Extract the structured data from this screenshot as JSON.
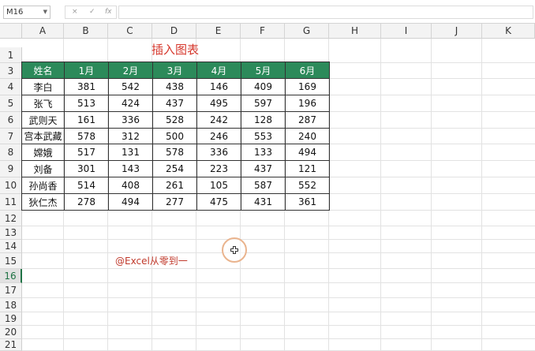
{
  "name_box": "M16",
  "formula_icons": [
    "×",
    "✓",
    "fx"
  ],
  "columns": [
    "A",
    "B",
    "C",
    "D",
    "E",
    "F",
    "G",
    "H",
    "I",
    "J",
    "K"
  ],
  "rows": [
    "1",
    "3",
    "4",
    "5",
    "6",
    "7",
    "8",
    "9",
    "10",
    "11",
    "12",
    "13",
    "14",
    "15",
    "16",
    "17",
    "18",
    "19",
    "20",
    "21"
  ],
  "active_row": "16",
  "title": "插入图表",
  "table": {
    "headers": [
      "姓名",
      "1月",
      "2月",
      "3月",
      "4月",
      "5月",
      "6月"
    ],
    "rows": [
      [
        "李白",
        "381",
        "542",
        "438",
        "146",
        "409",
        "169"
      ],
      [
        "张飞",
        "513",
        "424",
        "437",
        "495",
        "597",
        "196"
      ],
      [
        "武则天",
        "161",
        "336",
        "528",
        "242",
        "128",
        "287"
      ],
      [
        "宫本武藏",
        "578",
        "312",
        "500",
        "246",
        "553",
        "240"
      ],
      [
        "嫦娥",
        "517",
        "131",
        "578",
        "336",
        "133",
        "494"
      ],
      [
        "刘备",
        "301",
        "143",
        "254",
        "223",
        "437",
        "121"
      ],
      [
        "孙尚香",
        "514",
        "408",
        "261",
        "105",
        "587",
        "552"
      ],
      [
        "狄仁杰",
        "278",
        "494",
        "277",
        "475",
        "431",
        "361"
      ]
    ]
  },
  "watermark": "@Excel从零到一",
  "colors": {
    "header_fill": "#2c8a5a",
    "title": "#d6382d",
    "accent": "#217346"
  }
}
